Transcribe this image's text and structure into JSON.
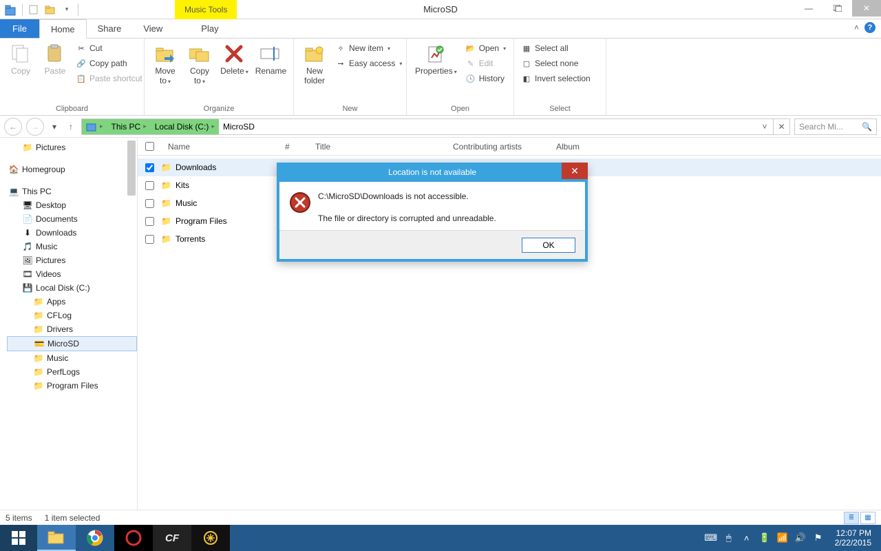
{
  "window": {
    "title": "MicroSD",
    "music_tools": "Music Tools"
  },
  "tabs": {
    "file": "File",
    "home": "Home",
    "share": "Share",
    "view": "View",
    "play": "Play"
  },
  "ribbon": {
    "clipboard": {
      "label": "Clipboard",
      "copy": "Copy",
      "paste": "Paste",
      "cut": "Cut",
      "copy_path": "Copy path",
      "paste_shortcut": "Paste shortcut"
    },
    "organize": {
      "label": "Organize",
      "move_to": "Move\nto",
      "copy_to": "Copy\nto",
      "delete": "Delete",
      "rename": "Rename"
    },
    "new": {
      "label": "New",
      "new_folder": "New\nfolder",
      "new_item": "New item",
      "easy_access": "Easy access"
    },
    "open": {
      "label": "Open",
      "properties": "Properties",
      "open": "Open",
      "edit": "Edit",
      "history": "History"
    },
    "select": {
      "label": "Select",
      "select_all": "Select all",
      "select_none": "Select none",
      "invert": "Invert selection"
    }
  },
  "breadcrumb": {
    "this_pc": "This PC",
    "local_disk": "Local Disk (C:)",
    "microsd": "MicroSD"
  },
  "search": {
    "placeholder": "Search Mi..."
  },
  "columns": {
    "name": "Name",
    "num": "#",
    "title": "Title",
    "contrib": "Contributing artists",
    "album": "Album"
  },
  "tree": {
    "pictures": "Pictures",
    "homegroup": "Homegroup",
    "this_pc": "This PC",
    "desktop": "Desktop",
    "documents": "Documents",
    "downloads": "Downloads",
    "music": "Music",
    "pictures2": "Pictures",
    "videos": "Videos",
    "local_disk": "Local Disk (C:)",
    "apps": "Apps",
    "cflog": "CFLog",
    "drivers": "Drivers",
    "microsd": "MicroSD",
    "music2": "Music",
    "perflogs": "PerfLogs",
    "program_files": "Program Files"
  },
  "files": [
    {
      "name": "Downloads",
      "checked": true
    },
    {
      "name": "Kits",
      "checked": false
    },
    {
      "name": "Music",
      "checked": false
    },
    {
      "name": "Program Files",
      "checked": false
    },
    {
      "name": "Torrents",
      "checked": false
    }
  ],
  "statusbar": {
    "count": "5 items",
    "selected": "1 item selected"
  },
  "dialog": {
    "title": "Location is not available",
    "line1": "C:\\MicroSD\\Downloads is not accessible.",
    "line2": "The file or directory is corrupted and unreadable.",
    "ok": "OK"
  },
  "clock": {
    "time": "12:07 PM",
    "date": "2/22/2015"
  }
}
